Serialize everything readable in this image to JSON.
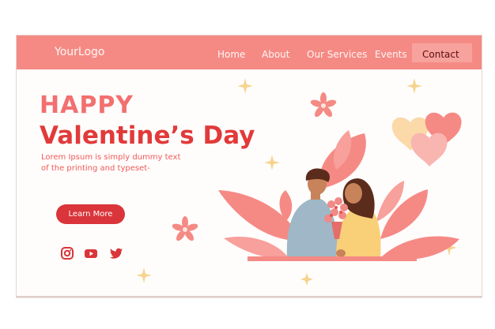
{
  "header": {
    "logo": "YourLogo",
    "nav": {
      "home": "Home",
      "about": "About",
      "services": "Our Services",
      "events": "Events",
      "contact": "Contact"
    }
  },
  "hero": {
    "kicker": "HAPPY",
    "title": "Valentine’s Day",
    "subtitle": "Lorem Ipsum is simply dummy text of the printing and typeset-",
    "cta": "Learn More"
  },
  "social": [
    "instagram-icon",
    "youtube-icon",
    "twitter-icon"
  ],
  "colors": {
    "header": "#f58a85",
    "accent": "#e13a3a",
    "button": "#d9353a",
    "leaf": "#f58a85"
  }
}
